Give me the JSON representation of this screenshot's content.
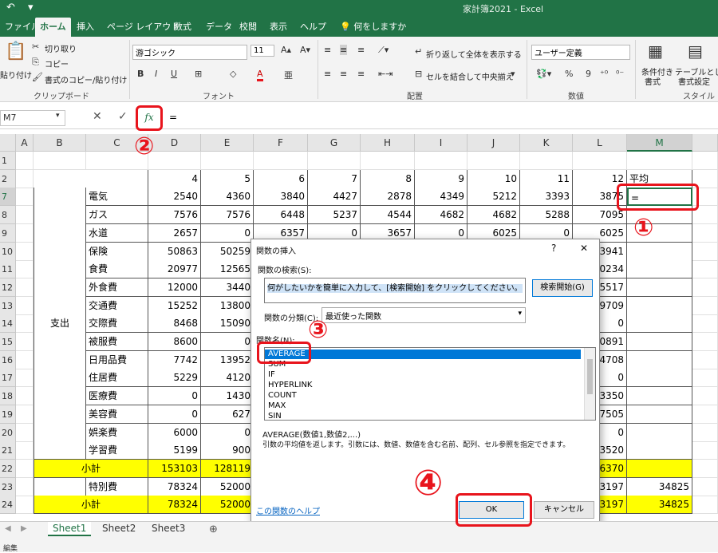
{
  "window": {
    "title": "家計簿2021  -  Excel",
    "quick_access": "↶ ▾"
  },
  "tabs": [
    {
      "label": "ファイル"
    },
    {
      "label": "ホーム"
    },
    {
      "label": "挿入"
    },
    {
      "label": "ページ レイアウト"
    },
    {
      "label": "数式"
    },
    {
      "label": "データ"
    },
    {
      "label": "校閲"
    },
    {
      "label": "表示"
    },
    {
      "label": "ヘルプ"
    },
    {
      "label": "何をしますか"
    }
  ],
  "ribbon": {
    "clipboard": {
      "paste": "貼り付け",
      "cut": "切り取り",
      "copy": "コピー",
      "format_painter": "書式のコピー/貼り付け",
      "group": "クリップボード"
    },
    "font": {
      "name": "游ゴシック",
      "size": "11",
      "bold": "B",
      "italic": "I",
      "underline": "U",
      "color": "A",
      "phonetic": "亜",
      "group": "フォント"
    },
    "alignment": {
      "wrap": "折り返して全体を表示する",
      "merge": "セルを結合して中央揃え",
      "group": "配置"
    },
    "number": {
      "format": "ユーザー定義",
      "percent": "%",
      "comma": "9",
      "group": "数値"
    },
    "styles": {
      "cond": "条件付き",
      "cond2": "書式",
      "table": "テーブルとして",
      "table2": "書式設定",
      "group": "スタイル"
    }
  },
  "formula_bar": {
    "name_box": "M7",
    "content": "=",
    "fx": "fx",
    "cancel": "✕",
    "enter": "✓"
  },
  "columns": [
    "A",
    "B",
    "C",
    "D",
    "E",
    "F",
    "G",
    "H",
    "I",
    "J",
    "K",
    "L",
    "M"
  ],
  "rows": [
    {
      "num": "1",
      "c": "",
      "vals": [
        "",
        "",
        "",
        "",
        "",
        "",
        "",
        "",
        ""
      ],
      "m": ""
    },
    {
      "num": "2",
      "c": "",
      "vals": [
        "4",
        "5",
        "6",
        "7",
        "8",
        "9",
        "10",
        "11",
        "12"
      ],
      "m": "平均"
    },
    {
      "num": "7",
      "c": "電気",
      "vals": [
        "2540",
        "4360",
        "3840",
        "4427",
        "2878",
        "4349",
        "5212",
        "3393",
        "3875"
      ],
      "m": "="
    },
    {
      "num": "8",
      "c": "ガス",
      "vals": [
        "7576",
        "7576",
        "6448",
        "5237",
        "4544",
        "4682",
        "4682",
        "5288",
        "7095"
      ],
      "m": ""
    },
    {
      "num": "9",
      "c": "水道",
      "vals": [
        "2657",
        "0",
        "6357",
        "0",
        "3657",
        "0",
        "6025",
        "0",
        "6025"
      ],
      "m": ""
    },
    {
      "num": "10",
      "c": "保険",
      "vals": [
        "50863",
        "50259",
        "",
        "",
        "",
        "",
        "",
        "",
        "3941"
      ],
      "m": ""
    },
    {
      "num": "11",
      "c": "食費",
      "vals": [
        "20977",
        "12565",
        "",
        "",
        "",
        "",
        "",
        "",
        "0234"
      ],
      "m": ""
    },
    {
      "num": "12",
      "c": "外食費",
      "vals": [
        "12000",
        "3440",
        "",
        "",
        "",
        "",
        "",
        "",
        "5517"
      ],
      "m": ""
    },
    {
      "num": "13",
      "c": "交通費",
      "vals": [
        "15252",
        "13800",
        "",
        "",
        "",
        "",
        "",
        "",
        "9709"
      ],
      "m": ""
    },
    {
      "num": "14",
      "c": "交際費",
      "vals": [
        "8468",
        "15090",
        "",
        "",
        "",
        "",
        "",
        "",
        "0"
      ],
      "m": ""
    },
    {
      "num": "15",
      "c": "被服費",
      "vals": [
        "8600",
        "0",
        "",
        "",
        "",
        "",
        "",
        "",
        "0891"
      ],
      "m": ""
    },
    {
      "num": "16",
      "c": "日用品費",
      "vals": [
        "7742",
        "13952",
        "",
        "",
        "",
        "",
        "",
        "",
        "4708"
      ],
      "m": ""
    },
    {
      "num": "17",
      "c": "住居費",
      "vals": [
        "5229",
        "4120",
        "",
        "",
        "",
        "",
        "",
        "",
        "0"
      ],
      "m": ""
    },
    {
      "num": "18",
      "c": "医療費",
      "vals": [
        "0",
        "1430",
        "",
        "",
        "",
        "",
        "",
        "",
        "3350"
      ],
      "m": ""
    },
    {
      "num": "19",
      "c": "美容費",
      "vals": [
        "0",
        "627",
        "",
        "",
        "",
        "",
        "",
        "",
        "7505"
      ],
      "m": ""
    },
    {
      "num": "20",
      "c": "娯楽費",
      "vals": [
        "6000",
        "0",
        "",
        "",
        "",
        "",
        "",
        "",
        "0"
      ],
      "m": ""
    },
    {
      "num": "21",
      "c": "学習費",
      "vals": [
        "5199",
        "900",
        "",
        "",
        "",
        "",
        "",
        "",
        "3520"
      ],
      "m": ""
    },
    {
      "num": "22",
      "c": "小計",
      "vals": [
        "153103",
        "128119",
        "",
        "",
        "",
        "",
        "",
        "",
        "6370"
      ],
      "m": ""
    },
    {
      "num": "23",
      "c": "特別費",
      "vals": [
        "78324",
        "52000",
        "",
        "",
        "",
        "",
        "",
        "",
        "3197"
      ],
      "m": "34825"
    },
    {
      "num": "24",
      "c": "小計",
      "vals": [
        "78324",
        "52000",
        "",
        "",
        "",
        "",
        "",
        "",
        "3197"
      ],
      "m": "34825"
    }
  ],
  "group_label": "支出",
  "sheet_tabs": [
    "Sheet1",
    "Sheet2",
    "Sheet3"
  ],
  "add_sheet": "⊕",
  "status": "編集",
  "dialog": {
    "title": "関数の挿入",
    "help": "?",
    "close": "✕",
    "search_label": "関数の検索(S):",
    "search_value": "何がしたいかを簡単に入力して、[検索開始] をクリックしてください。",
    "search_button": "検索開始(G)",
    "category_label": "関数の分類(C):",
    "category_value": "最近使った関数",
    "name_label": "関数名(N):",
    "functions": [
      "AVERAGE",
      "SUM",
      "IF",
      "HYPERLINK",
      "COUNT",
      "MAX",
      "SIN"
    ],
    "syntax": "AVERAGE(数値1,数値2,...)",
    "description": "引数の平均値を返します。引数には、数値、数値を含む名前、配列、セル参照を指定できます。",
    "help_link": "この関数のヘルプ",
    "ok": "OK",
    "cancel": "キャンセル"
  },
  "annotations": [
    "①",
    "②",
    "③",
    "④"
  ],
  "colors": {
    "excel_green": "#217346",
    "highlight_yellow": "#ffff00",
    "annotation_red": "#e8141c",
    "selection_blue": "#0078d7"
  }
}
